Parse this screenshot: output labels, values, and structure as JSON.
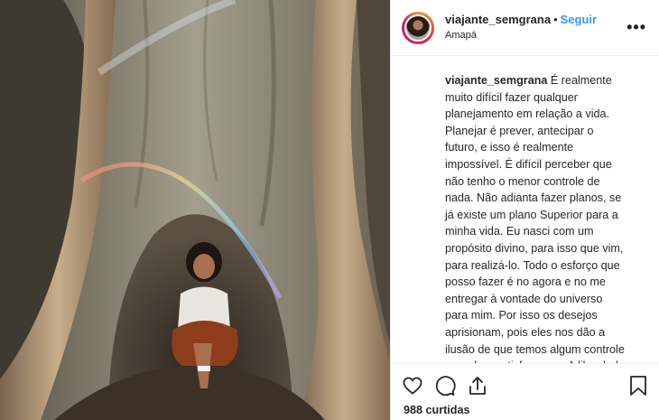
{
  "post": {
    "username": "viajante_semgrana",
    "separator": "•",
    "follow_label": "Seguir",
    "location": "Amapá",
    "more_icon": "ellipsis-icon",
    "caption_user": "viajante_semgrana",
    "caption_text": " É realmente muito difícil fazer qualquer planejamento em relação a vida. Planejar é prever, antecipar o futuro, e isso é realmente impossível. É difícil perceber que não tenho o menor controle de nada. Não adianta fazer planos, se já existe um plano Superior para a minha vida. Eu nasci com um propósito divino, para isso que vim, para realizá-lo. Todo o esforço que posso fazer é no agora e no me entregar à vontade do universo para mim. Por isso os desejos aprisionam, pois eles nos dão a ilusão de que temos algum controle quando o satisfazemos. A liberdade tem a ver com não desejar, não desejar, apenas se entregar ao que o universo tem pra você. Sem julgamentos, não julgue em boa ou",
    "likes": "988 curtidas",
    "icons": [
      "heart-icon",
      "comment-icon",
      "share-icon",
      "bookmark-icon"
    ],
    "colors": {
      "accent": "#3897f0",
      "text": "#262626",
      "border": "#efefef"
    }
  }
}
